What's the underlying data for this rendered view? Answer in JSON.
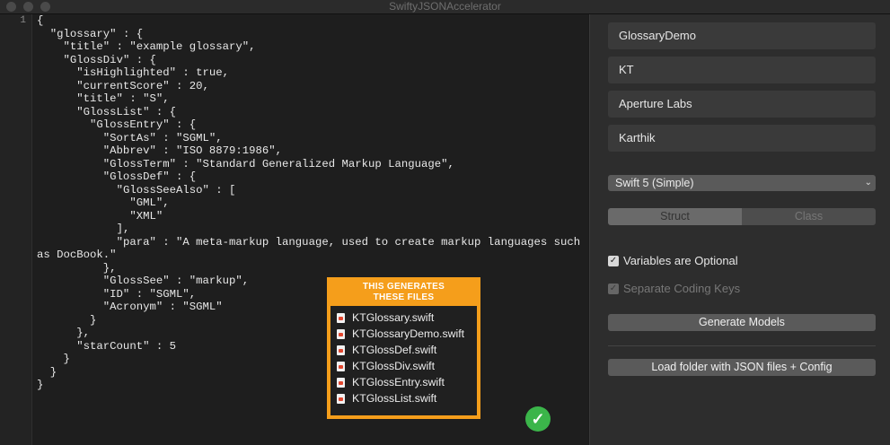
{
  "window": {
    "title": "SwiftyJSONAccelerator"
  },
  "editor": {
    "line_number": "1",
    "code": "{\n  \"glossary\" : {\n    \"title\" : \"example glossary\",\n    \"GlossDiv\" : {\n      \"isHighlighted\" : true,\n      \"currentScore\" : 20,\n      \"title\" : \"S\",\n      \"GlossList\" : {\n        \"GlossEntry\" : {\n          \"SortAs\" : \"SGML\",\n          \"Abbrev\" : \"ISO 8879:1986\",\n          \"GlossTerm\" : \"Standard Generalized Markup Language\",\n          \"GlossDef\" : {\n            \"GlossSeeAlso\" : [\n              \"GML\",\n              \"XML\"\n            ],\n            \"para\" : \"A meta-markup language, used to create markup languages such as DocBook.\"\n          },\n          \"GlossSee\" : \"markup\",\n          \"ID\" : \"SGML\",\n          \"Acronym\" : \"SGML\"\n        }\n      },\n      \"starCount\" : 5\n    }\n  }\n}"
  },
  "panel": {
    "fields": [
      "GlossaryDemo",
      "KT",
      "Aperture Labs",
      "Karthik"
    ],
    "language_select": "Swift 5 (Simple)",
    "segments": [
      "Struct",
      "Class"
    ],
    "options": [
      {
        "label": "Variables are Optional",
        "checked": true,
        "enabled": true
      },
      {
        "label": "Separate Coding Keys",
        "checked": true,
        "enabled": false
      }
    ],
    "generate_button": "Generate Models",
    "load_button": "Load folder with JSON files + Config"
  },
  "callout": {
    "title_line1": "THIS GENERATES",
    "title_line2": "THESE FILES",
    "files": [
      "KTGlossary.swift",
      "KTGlossaryDemo.swift",
      "KTGlossDef.swift",
      "KTGlossDiv.swift",
      "KTGlossEntry.swift",
      "KTGlossList.swift"
    ]
  },
  "status": {
    "icon": "checkmark-icon",
    "color": "#3bb54a"
  }
}
